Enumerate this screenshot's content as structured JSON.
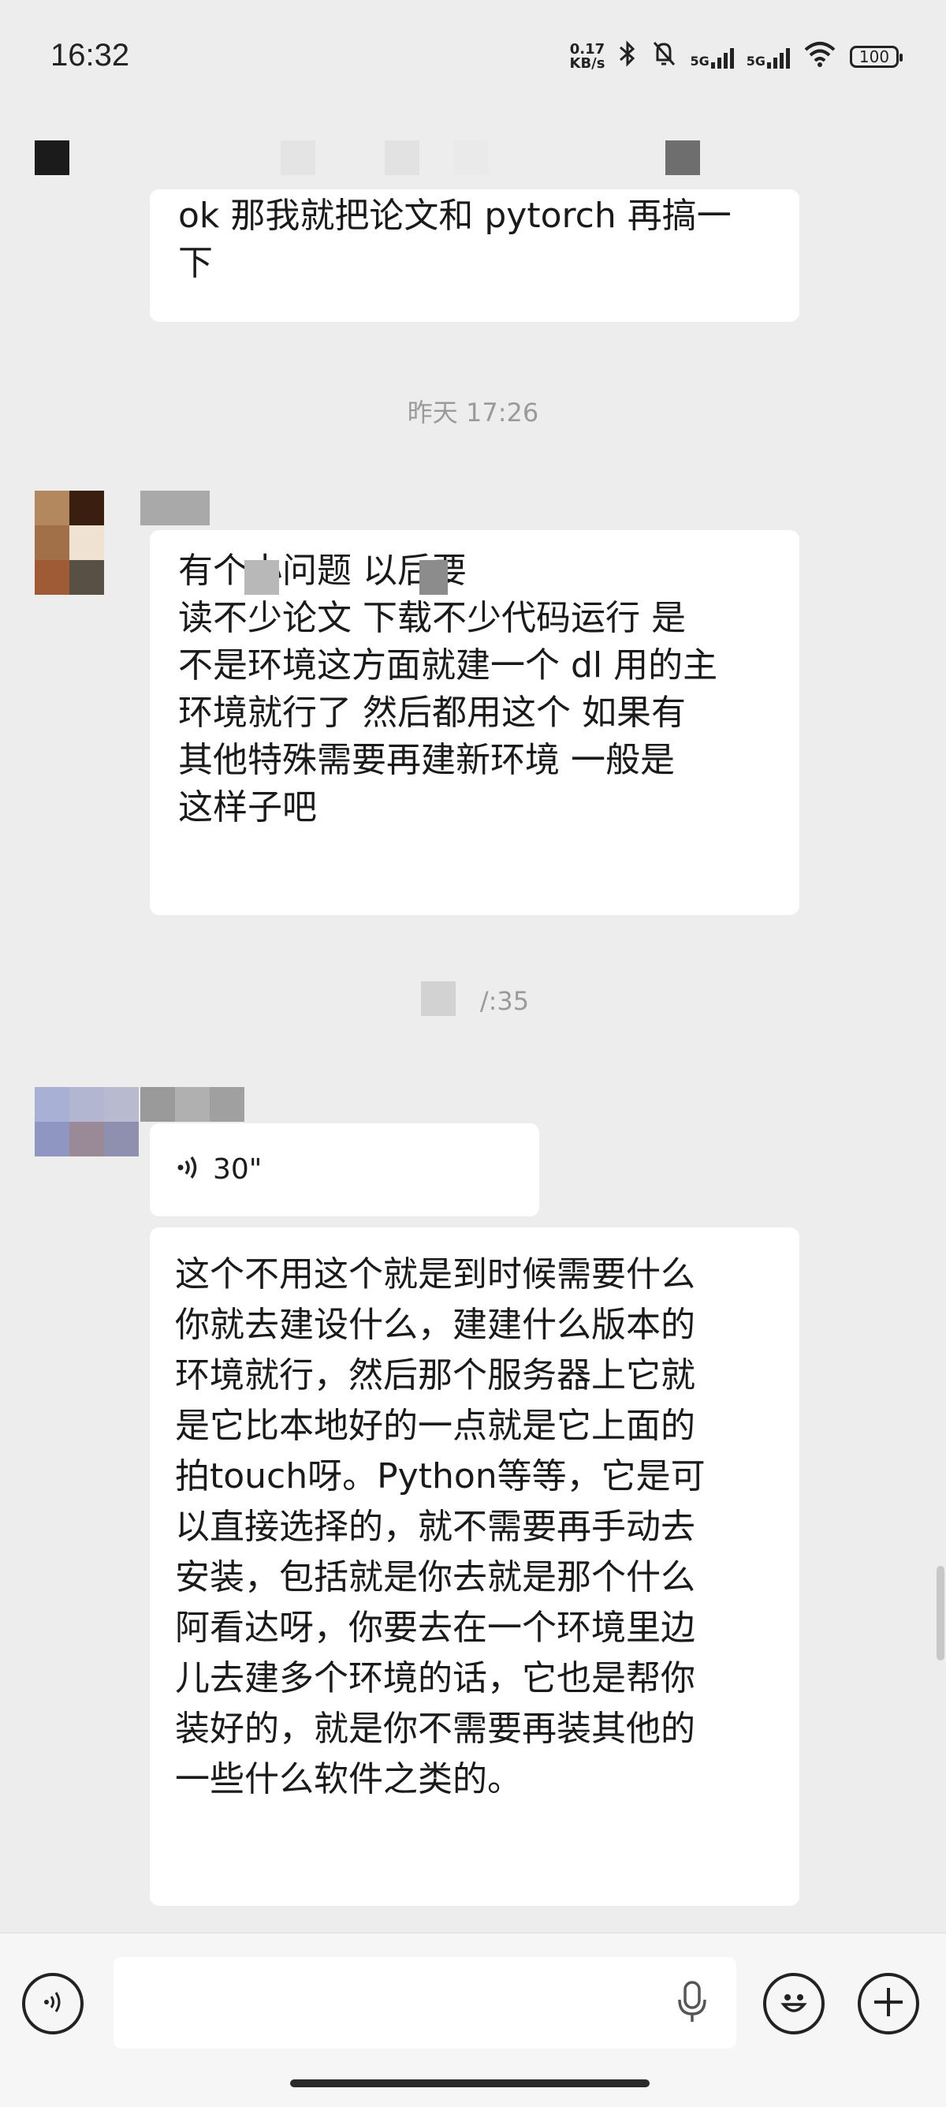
{
  "status_bar": {
    "time": "16:32",
    "net_speed_value": "0.17",
    "net_speed_unit": "KB/s",
    "signal1": "5G",
    "signal2": "5G",
    "battery": "100"
  },
  "messages": [
    {
      "sender": "self",
      "text": "ok 那我就把论文和 pytorch 再搞一\n下"
    },
    {
      "type": "timestamp",
      "text": "昨天 17:26"
    },
    {
      "sender": "contact",
      "text": "有个小问题 以后要\n读不少论文 下载不少代码运行 是\n不是环境这方面就建一个 dl 用的主\n环境就行了 然后都用这个 如果有\n其他特殊需要再建新环境 一般是\n这样子吧"
    },
    {
      "type": "timestamp",
      "text": "/:35"
    },
    {
      "sender": "contact",
      "type": "voice",
      "duration": "30\""
    },
    {
      "sender": "contact",
      "type": "transcript",
      "text": "这个不用这个就是到时候需要什么\n你就去建设什么，建建什么版本的\n环境就行，然后那个服务器上它就\n是它比本地好的一点就是它上面的\n拍touch呀。Python等等，它是可\n以直接选择的，就不需要再手动去\n安装，包括就是你去就是那个什么\n阿看达呀，你要去在一个环境里边\n儿去建多个环境的话，它也是帮你\n装好的，就是你不需要再装其他的\n一些什么软件之类的。"
    }
  ],
  "input_bar": {
    "voice_toggle_icon": "voice-wave-icon",
    "mic_icon": "microphone-icon",
    "emoji_icon": "emoji-smile-icon",
    "plus_icon": "plus-icon",
    "placeholder": ""
  },
  "colors": {
    "background": "#ededed",
    "bubble": "#ffffff",
    "timestamp": "#9a9a9a"
  }
}
